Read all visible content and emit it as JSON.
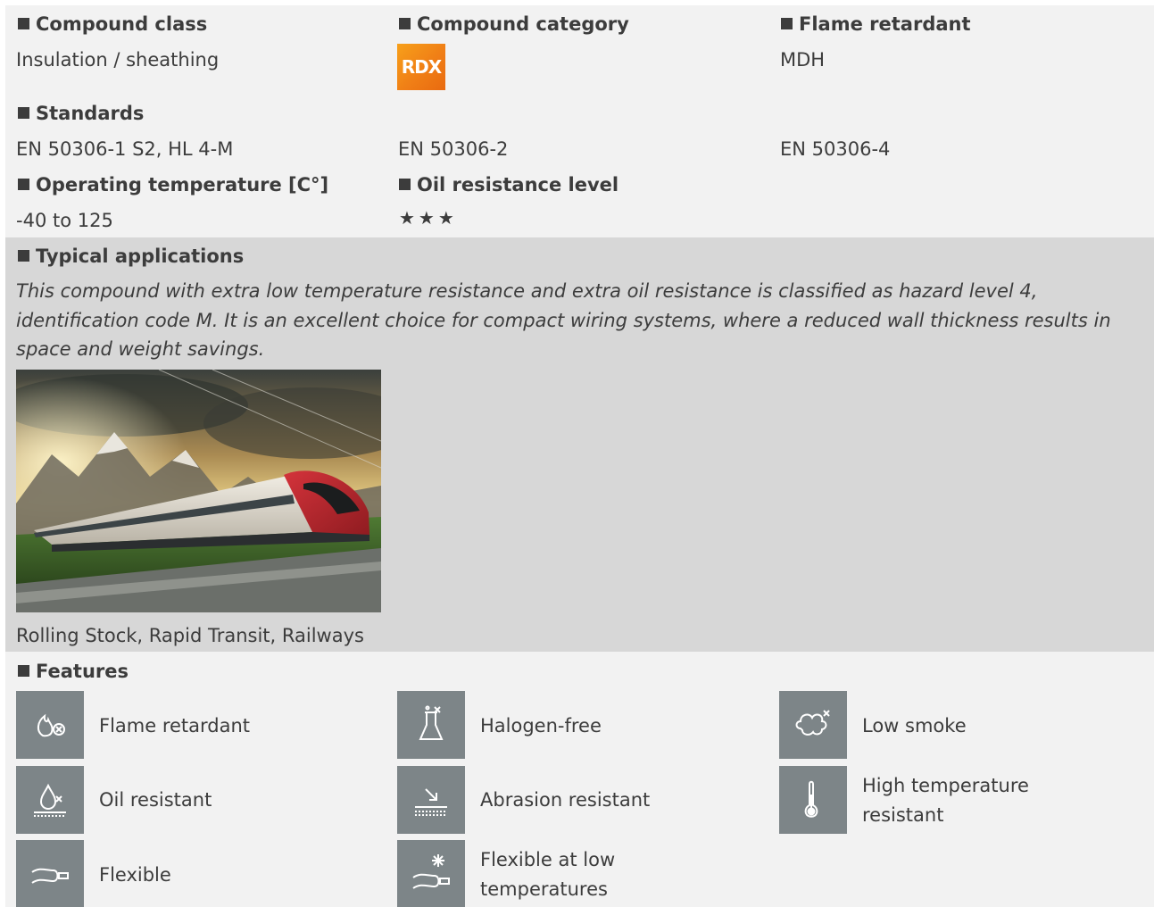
{
  "compound_class": {
    "label": "Compound class",
    "value": "Insulation / sheathing"
  },
  "compound_category": {
    "label": "Compound category",
    "badge": "RDX",
    "badge_color": "#f07f16"
  },
  "flame_retardant": {
    "label": "Flame retardant",
    "value": "MDH"
  },
  "standards": {
    "label": "Standards",
    "items": [
      "EN 50306-1 S2, HL 4-M",
      "EN 50306-2",
      "EN 50306-4"
    ]
  },
  "operating_temperature": {
    "label": "Operating temperature [C°]",
    "value": "-40 to 125"
  },
  "oil_resistance": {
    "label": "Oil resistance level",
    "stars": "★★★",
    "level": 3
  },
  "typical_applications": {
    "label": "Typical applications",
    "description": "This compound with extra low temperature resistance and extra oil resistance is classified as hazard level 4, identification code M. It is an excellent choice for compact wiring systems, where a reduced wall thickness results in space and weight savings.",
    "caption": "Rolling Stock, Rapid Transit, Railways"
  },
  "features": {
    "label": "Features",
    "items": [
      {
        "label": "Flame retardant",
        "icon": "flame-retardant-icon"
      },
      {
        "label": "Halogen-free",
        "icon": "halogen-free-icon"
      },
      {
        "label": "Low smoke",
        "icon": "low-smoke-icon"
      },
      {
        "label": "Oil resistant",
        "icon": "oil-resistant-icon"
      },
      {
        "label": "Abrasion resistant",
        "icon": "abrasion-resistant-icon"
      },
      {
        "label": "High temperature resistant",
        "icon": "thermometer-icon"
      },
      {
        "label": "Flexible",
        "icon": "flexible-cable-icon"
      },
      {
        "label": "Flexible at low temperatures",
        "icon": "flexible-low-temp-icon"
      }
    ]
  },
  "colors": {
    "panel_light": "#f2f2f2",
    "panel_dark": "#d7d7d7",
    "icon_bg": "#7d8588",
    "text": "#3c3c3c"
  }
}
